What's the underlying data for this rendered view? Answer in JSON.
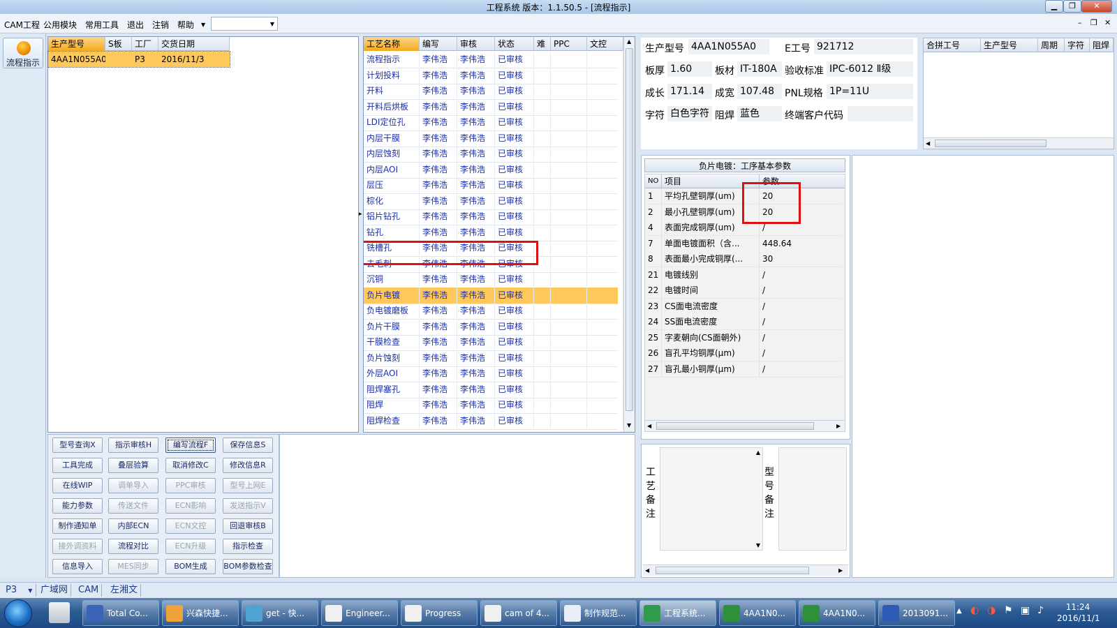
{
  "window": {
    "title": "工程系统  版本：1.1.50.5 - [流程指示]"
  },
  "menu": {
    "items": [
      "CAM工程",
      "公用模块",
      "常用工具",
      "退出",
      "注销",
      "帮助"
    ],
    "combo_value": ""
  },
  "left_strip": {
    "flow_label": "流程指示"
  },
  "order_grid": {
    "headers": [
      "生产型号",
      "S板",
      "工厂",
      "交货日期"
    ],
    "row": [
      "4AA1N055A0",
      "",
      "P3",
      "2016/11/3"
    ]
  },
  "process_grid": {
    "headers": [
      "工艺名称",
      "编写",
      "审核",
      "状态",
      "难",
      "PPC",
      "文控"
    ],
    "rows": [
      [
        "流程指示",
        "李伟浩",
        "李伟浩",
        "已审核"
      ],
      [
        "计划投料",
        "李伟浩",
        "李伟浩",
        "已审核"
      ],
      [
        "开料",
        "李伟浩",
        "李伟浩",
        "已审核"
      ],
      [
        "开料后烘板",
        "李伟浩",
        "李伟浩",
        "已审核"
      ],
      [
        "LDI定位孔",
        "李伟浩",
        "李伟浩",
        "已审核"
      ],
      [
        "内层干膜",
        "李伟浩",
        "李伟浩",
        "已审核"
      ],
      [
        "内层蚀刻",
        "李伟浩",
        "李伟浩",
        "已审核"
      ],
      [
        "内层AOI",
        "李伟浩",
        "李伟浩",
        "已审核"
      ],
      [
        "层压",
        "李伟浩",
        "李伟浩",
        "已审核"
      ],
      [
        "棕化",
        "李伟浩",
        "李伟浩",
        "已审核"
      ],
      [
        "铝片钻孔",
        "李伟浩",
        "李伟浩",
        "已审核"
      ],
      [
        "钻孔",
        "李伟浩",
        "李伟浩",
        "已审核"
      ],
      [
        "铣槽孔",
        "李伟浩",
        "李伟浩",
        "已审核"
      ],
      [
        "去毛刺",
        "李伟浩",
        "李伟浩",
        "已审核"
      ],
      [
        "沉铜",
        "李伟浩",
        "李伟浩",
        "已审核"
      ],
      [
        "负片电镀",
        "李伟浩",
        "李伟浩",
        "已审核"
      ],
      [
        "负电镀磨板",
        "李伟浩",
        "李伟浩",
        "已审核"
      ],
      [
        "负片干膜",
        "李伟浩",
        "李伟浩",
        "已审核"
      ],
      [
        "干膜检查",
        "李伟浩",
        "李伟浩",
        "已审核"
      ],
      [
        "负片蚀刻",
        "李伟浩",
        "李伟浩",
        "已审核"
      ],
      [
        "外层AOI",
        "李伟浩",
        "李伟浩",
        "已审核"
      ],
      [
        "阻焊塞孔",
        "李伟浩",
        "李伟浩",
        "已审核"
      ],
      [
        "阻焊",
        "李伟浩",
        "李伟浩",
        "已审核"
      ],
      [
        "阻焊检查",
        "李伟浩",
        "李伟浩",
        "已审核"
      ]
    ]
  },
  "buttons": [
    [
      "型号查询X",
      "指示审核H",
      "编写流程F",
      "保存信息S"
    ],
    [
      "工具完成",
      "叠层验算",
      "取消修改C",
      "修改信息R"
    ],
    [
      "在线WIP",
      "调单导入",
      "PPC审核",
      "型号上网E"
    ],
    [
      "能力参数",
      "传送文件",
      "ECN影响",
      "发送指示V"
    ],
    [
      "制作通知单",
      "内部ECN",
      "ECN文控",
      "回退审核B"
    ],
    [
      "接外调资料",
      "流程对比",
      "ECN升级",
      "指示检查"
    ],
    [
      "信息导入",
      "MES同步",
      "BOM生成",
      "BOM参数检查"
    ]
  ],
  "info": {
    "part_label": "生产型号",
    "part_value": "4AA1N055A0",
    "eno_label": "E工号",
    "eno_value": "921712",
    "thick_label": "板厚",
    "thick_value": "1.60",
    "mat_label": "板材",
    "mat_value": "IT-180A",
    "std_label": "验收标准",
    "std_value": "IPC-6012 Ⅱ级",
    "len_label": "成长",
    "len_value": "171.14",
    "wid_label": "成宽",
    "wid_value": "107.48",
    "pnl_label": "PNL规格",
    "pnl_value": "1P=11U",
    "char_label": "字符",
    "char_value": "白色字符",
    "mask_label": "阻焊",
    "mask_value": "蓝色",
    "cust_label": "终端客户代码",
    "cust_value": ""
  },
  "merge_grid": {
    "headers": [
      "合拼工号",
      "生产型号",
      "周期",
      "字符",
      "阻焊"
    ]
  },
  "params": {
    "title": "负片电镀：工序基本参数",
    "headers": [
      "NO",
      "项目",
      "参数"
    ],
    "rows": [
      [
        "1",
        "平均孔壁铜厚(um)",
        "20"
      ],
      [
        "2",
        "最小孔壁铜厚(um)",
        "20"
      ],
      [
        "4",
        "表面完成铜厚(um)",
        "/"
      ],
      [
        "7",
        "单面电镀面积（含...",
        "448.64"
      ],
      [
        "8",
        "表面最小完成铜厚(...",
        "30"
      ],
      [
        "21",
        "电镀线别",
        "/"
      ],
      [
        "22",
        "电镀时间",
        "/"
      ],
      [
        "23",
        "CS面电流密度",
        "/"
      ],
      [
        "24",
        "SS面电流密度",
        "/"
      ],
      [
        "25",
        "字麦朝向(CS面朝外)",
        "/"
      ],
      [
        "26",
        "盲孔平均铜厚(μm)",
        "/"
      ],
      [
        "27",
        "盲孔最小铜厚(μm)",
        "/"
      ]
    ]
  },
  "notes": {
    "process_note": "工艺备注",
    "model_note": "型号备注"
  },
  "status": {
    "factory": "P3",
    "items": [
      "广域网",
      "CAM",
      "左湘文"
    ]
  },
  "taskbar": {
    "items": [
      "Total Co...",
      "兴森快捷...",
      "get - 快...",
      "Engineer...",
      "Progress",
      "cam of 4...",
      "制作规范...",
      "工程系统...",
      "4AA1N0...",
      "4AA1N0...",
      "2013091..."
    ],
    "time": "11:24",
    "date": "2016/11/1"
  },
  "colors": {
    "selection": "#ffc85a",
    "highlight_box": "#e01010",
    "accent_text": "#1a2fa8"
  }
}
